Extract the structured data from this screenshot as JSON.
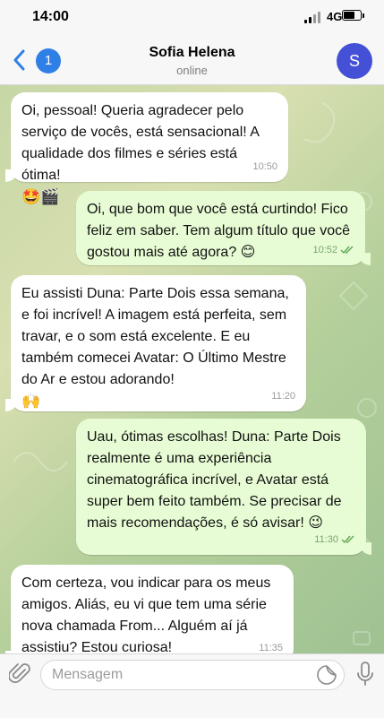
{
  "status_bar": {
    "time": "14:00",
    "network": "4G",
    "battery_level": 0.7
  },
  "header": {
    "back_badge": "1",
    "contact_name": "Sofia Helena",
    "contact_status": "online",
    "avatar_letter": "S"
  },
  "messages": [
    {
      "direction": "incoming",
      "text": "Oi, pessoal! Queria agradecer pelo serviço de vocês, está sensacional! A qualidade dos filmes e séries está ótima!",
      "emoji": "🤩🎬",
      "time": "10:50"
    },
    {
      "direction": "outgoing",
      "text": "Oi, que bom que você está curtindo! Fico feliz em saber. Tem algum título que você gostou mais até agora? 😊",
      "time": "10:52",
      "read": true
    },
    {
      "direction": "incoming",
      "text": "Eu assisti Duna: Parte Dois essa semana, e foi incrível! A imagem está perfeita, sem travar, e o som está excelente. E eu também comecei Avatar: O Último Mestre do Ar e estou adorando!",
      "emoji": "🙌",
      "time": "11:20"
    },
    {
      "direction": "outgoing",
      "text": "Uau, ótimas escolhas! Duna: Parte Dois realmente é uma experiência cinematográfica incrível, e Avatar está super bem feito também. Se precisar de mais recomendações, é só avisar! 😉",
      "time": "11:30",
      "read": true
    },
    {
      "direction": "incoming",
      "text": "Com certeza, vou indicar para os meus amigos. Aliás, eu vi que tem uma série nova chamada From... Alguém aí já assistiu? Estou curiosa!",
      "time": "11:35"
    }
  ],
  "input": {
    "placeholder": "Mensagem"
  },
  "colors": {
    "accent": "#2f80e6",
    "outgoing_bubble": "#e7fcd4",
    "incoming_bubble": "#ffffff",
    "avatar": "#4451d6"
  },
  "icons": {
    "back": "chevron-left-icon",
    "attach": "paperclip-icon",
    "sticker": "sticker-icon",
    "mic": "microphone-icon",
    "read": "double-check-icon"
  }
}
